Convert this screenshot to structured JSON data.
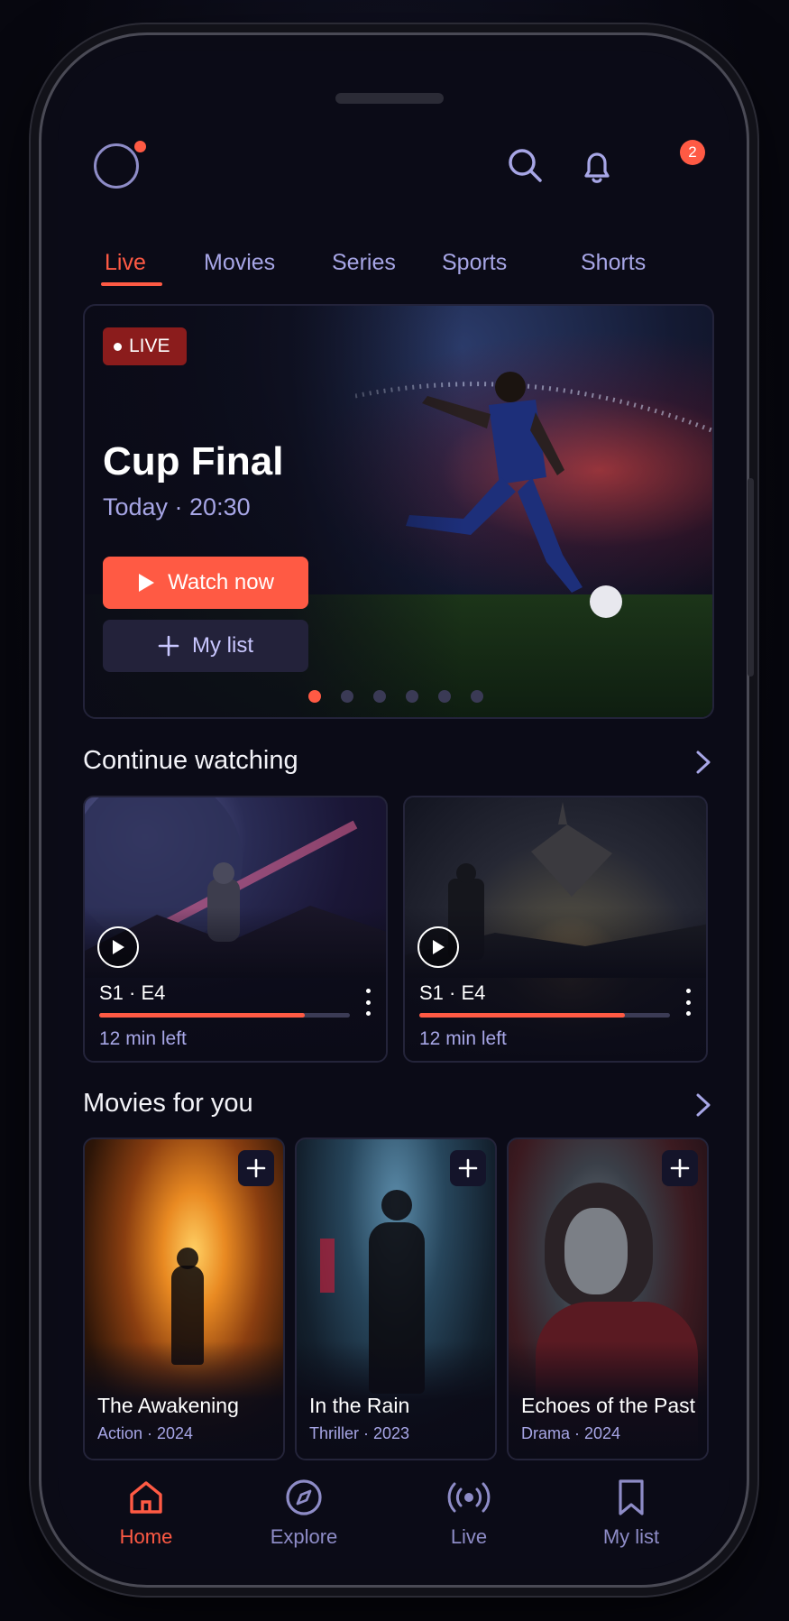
{
  "header": {
    "notifications_count": "2",
    "avatar_icon": "profile-ring-icon",
    "search_icon": "search-icon",
    "bell_icon": "bell-icon"
  },
  "tabs": [
    {
      "label": "Live",
      "active": true
    },
    {
      "label": "Movies",
      "active": false
    },
    {
      "label": "Series",
      "active": false
    },
    {
      "label": "Sports",
      "active": false
    },
    {
      "label": "Shorts",
      "active": false
    }
  ],
  "hero": {
    "badge": "LIVE",
    "title": "Cup Final",
    "subtitle": "Today · 20:30",
    "watch_label": "Watch now",
    "list_label": "My list",
    "carousel_pages": 6,
    "carousel_active_index": 0
  },
  "continue_watching": {
    "title": "Continue watching",
    "items": [
      {
        "episode": "S1 · E4",
        "remaining": "12 min left",
        "progress": 0.82
      },
      {
        "episode": "S1 · E4",
        "remaining": "12 min left",
        "progress": 0.82
      }
    ]
  },
  "movies": {
    "title": "Movies for you",
    "items": [
      {
        "title": "The Awakening",
        "meta": "Action · 2024"
      },
      {
        "title": "In the Rain",
        "meta": "Thriller · 2023"
      },
      {
        "title": "Echoes of the Past",
        "meta": "Drama · 2024"
      }
    ]
  },
  "nav": [
    {
      "label": "Home",
      "icon": "home-icon",
      "active": true
    },
    {
      "label": "Explore",
      "icon": "compass-icon",
      "active": false
    },
    {
      "label": "Live",
      "icon": "broadcast-icon",
      "active": false
    },
    {
      "label": "My list",
      "icon": "bookmark-icon",
      "active": false
    }
  ],
  "colors": {
    "accent": "#ff5a44",
    "muted_text": "#a7a6e6",
    "background": "#0b0b17"
  }
}
